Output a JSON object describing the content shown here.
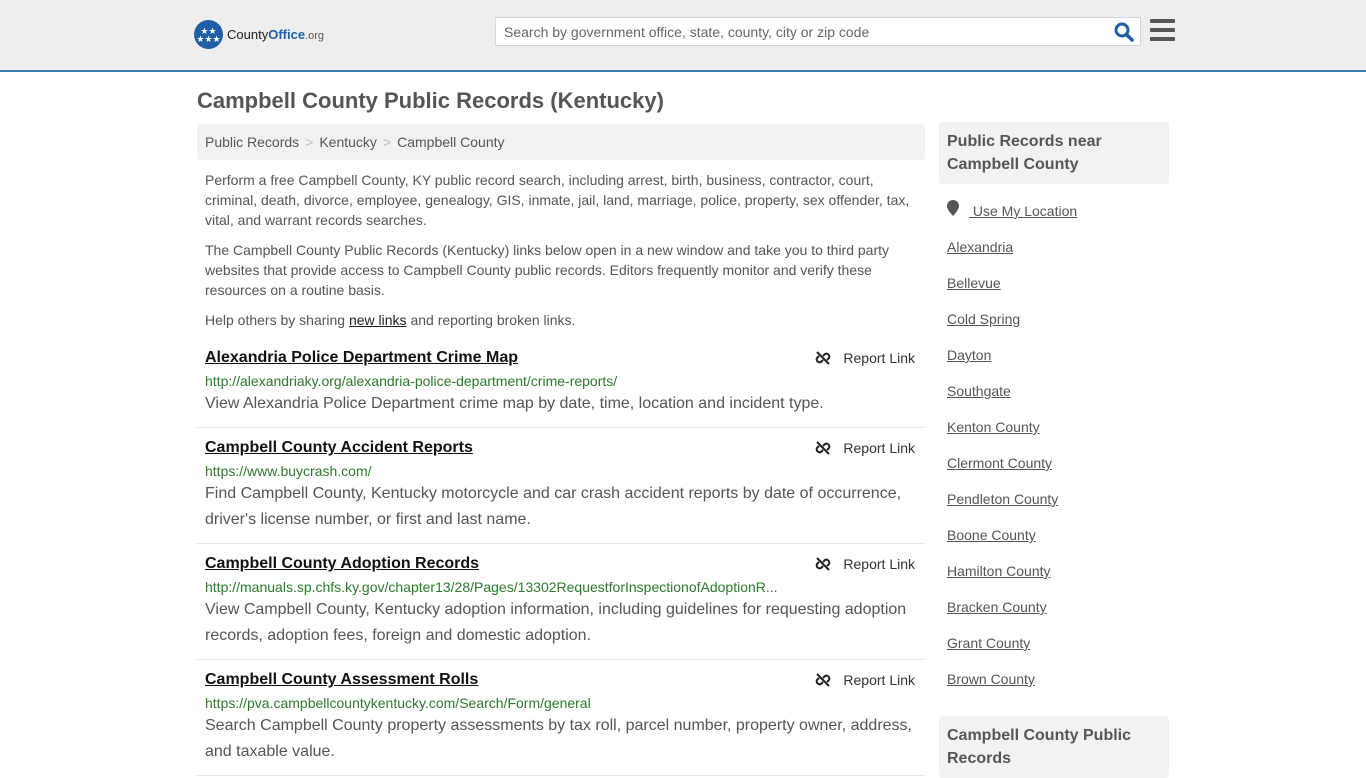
{
  "header": {
    "logo": {
      "name_part1": "County",
      "name_part2": "Office",
      "tld": ".org"
    },
    "search": {
      "placeholder": "Search by government office, state, county, city or zip code",
      "value": ""
    },
    "icons": {
      "search": "search-icon",
      "menu": "hamburger-menu-icon"
    }
  },
  "page_title": "Campbell County Public Records (Kentucky)",
  "breadcrumb": [
    "Public Records",
    "Kentucky",
    "Campbell County"
  ],
  "intro": {
    "p1": "Perform a free Campbell County, KY public record search, including arrest, birth, business, contractor, court, criminal, death, divorce, employee, genealogy, GIS, inmate, jail, land, marriage, police, property, sex offender, tax, vital, and warrant records searches.",
    "p2": "The Campbell County Public Records (Kentucky) links below open in a new window and take you to third party websites that provide access to Campbell County public records. Editors frequently monitor and verify these resources on a routine basis.",
    "p3_before": "Help others by sharing ",
    "p3_link": "new links",
    "p3_after": " and reporting broken links."
  },
  "report_label": "Report Link",
  "records": [
    {
      "title": "Alexandria Police Department Crime Map",
      "url": "http://alexandriaky.org/alexandria-police-department/crime-reports/",
      "description": "View Alexandria Police Department crime map by date, time, location and incident type."
    },
    {
      "title": "Campbell County Accident Reports",
      "url": "https://www.buycrash.com/",
      "description": "Find Campbell County, Kentucky motorcycle and car crash accident reports by date of occurrence, driver's license number, or first and last name."
    },
    {
      "title": "Campbell County Adoption Records",
      "url": "http://manuals.sp.chfs.ky.gov/chapter13/28/Pages/13302RequestforInspectionofAdoptionR...",
      "description": "View Campbell County, Kentucky adoption information, including guidelines for requesting adoption records, adoption fees, foreign and domestic adoption."
    },
    {
      "title": "Campbell County Assessment Rolls",
      "url": "https://pva.campbellcountykentucky.com/Search/Form/general",
      "description": "Search Campbell County property assessments by tax roll, parcel number, property owner, address, and taxable value."
    }
  ],
  "sidebar": {
    "heading": "Public Records near Campbell County",
    "use_location": "Use My Location",
    "places": [
      "Alexandria",
      "Bellevue",
      "Cold Spring",
      "Dayton",
      "Southgate",
      "Kenton County",
      "Clermont County",
      "Pendleton County",
      "Boone County",
      "Hamilton County",
      "Bracken County",
      "Grant County",
      "Brown County"
    ],
    "heading2": "Campbell County Public Records"
  }
}
